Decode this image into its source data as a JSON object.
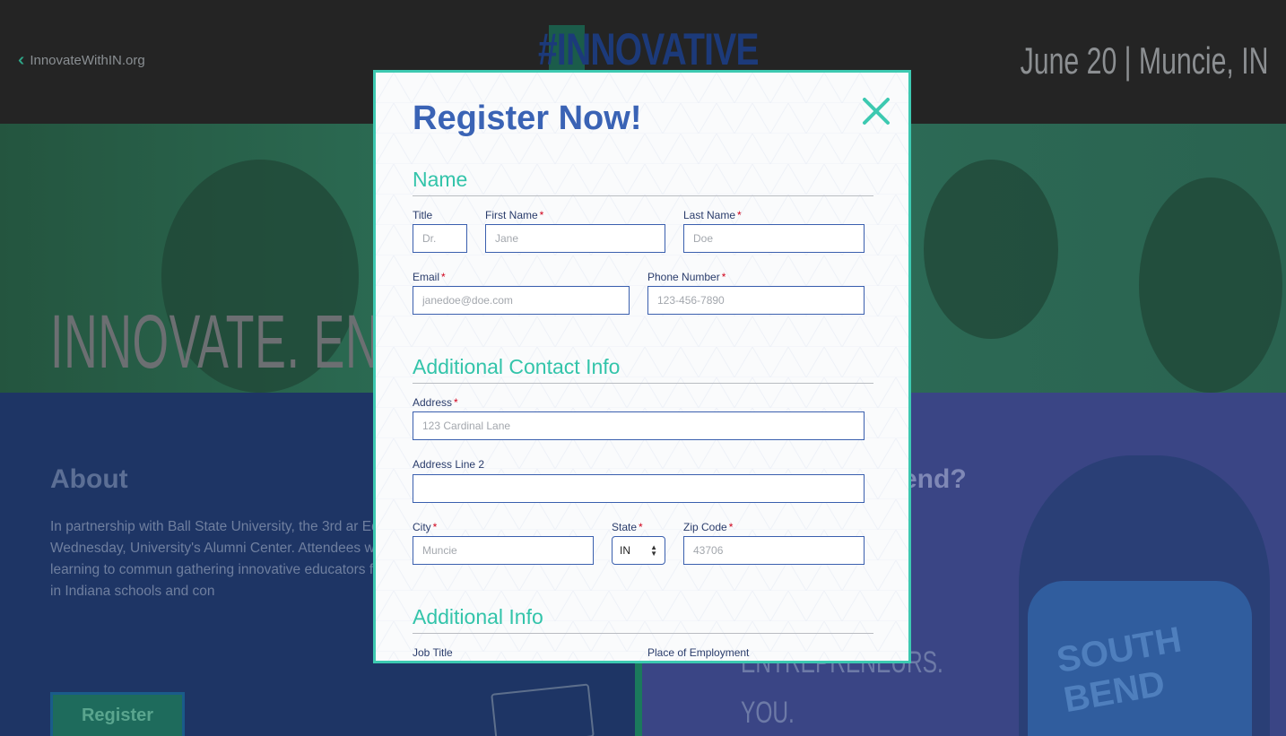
{
  "header": {
    "site_link": "InnovateWithIN.org",
    "brand": "#INNOVATIVE",
    "event_date": "June 20 | Muncie, IN"
  },
  "hero": {
    "headline": "INNOVATE. EN"
  },
  "about": {
    "title": "About",
    "body": "In partnership with Ball State University, the 3rd ar Educator Conference will be held on Wednesday, University's Alumni Center. Attendees will explore spanning from project-based learning to commun gathering innovative educators from around the s aims to inspire growth in Indiana schools and con",
    "register_label": "Register"
  },
  "attend": {
    "title": "end?",
    "items": [
      "ENTREPRENEURS.",
      "YOU."
    ],
    "shirt_text": "SOUTH BEND"
  },
  "modal": {
    "title": "Register Now!",
    "close_icon": "close-icon",
    "sections": {
      "name": "Name",
      "contact": "Additional Contact Info",
      "info": "Additional Info"
    },
    "fields": {
      "title": {
        "label": "Title",
        "placeholder": "Dr."
      },
      "first_name": {
        "label": "First Name",
        "placeholder": "Jane",
        "required": "*"
      },
      "last_name": {
        "label": "Last Name",
        "placeholder": "Doe",
        "required": "*"
      },
      "email": {
        "label": "Email",
        "placeholder": "janedoe@doe.com",
        "required": "*"
      },
      "phone": {
        "label": "Phone Number",
        "placeholder": "123-456-7890",
        "required": "*"
      },
      "address": {
        "label": "Address",
        "placeholder": "123 Cardinal Lane",
        "required": "*"
      },
      "address2": {
        "label": "Address Line 2",
        "placeholder": ""
      },
      "city": {
        "label": "City",
        "placeholder": "Muncie",
        "required": "*"
      },
      "state": {
        "label": "State",
        "value": "IN",
        "required": "*"
      },
      "zip": {
        "label": "Zip Code",
        "placeholder": "43706",
        "required": "*"
      },
      "job_title": {
        "label": "Job Title"
      },
      "employment": {
        "label": "Place of Employment"
      }
    }
  },
  "colors": {
    "accent_teal": "#3dc9b1",
    "title_blue": "#3a63b5",
    "required_red": "#d0021b"
  }
}
